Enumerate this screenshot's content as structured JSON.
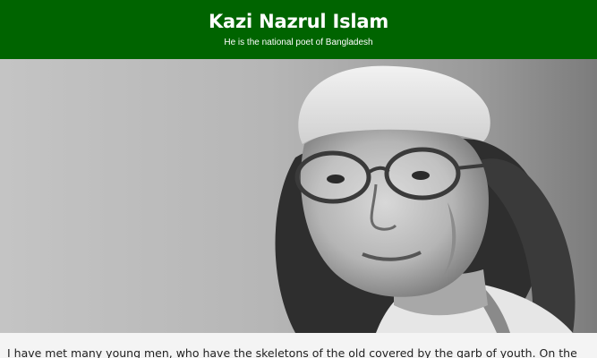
{
  "header": {
    "title": "Kazi Nazrul Islam",
    "subtitle": "He is the national poet of Bangladesh",
    "background_color": "#006400"
  },
  "hero": {
    "alt": "Black and white portrait photograph of Kazi Nazrul Islam wearing a cap and round glasses"
  },
  "article": {
    "text": "I have met many young men, who have the skeletons of the old covered by the garb of youth. On the"
  }
}
